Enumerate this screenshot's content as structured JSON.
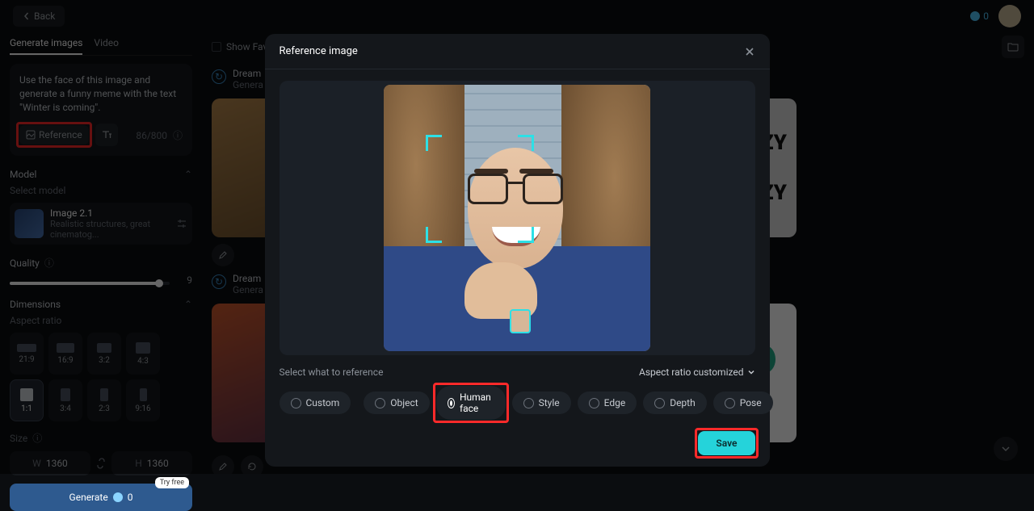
{
  "topbar": {
    "back": "Back",
    "credits": "0"
  },
  "tabs": {
    "generate_images": "Generate images",
    "video": "Video"
  },
  "prompt": {
    "text": "Use the face of this image and generate a funny meme with the text \"Winter is coming\".",
    "reference_label": "Reference",
    "char_counter": "86/800"
  },
  "model": {
    "header": "Model",
    "select_label": "Select model",
    "name": "Image 2.1",
    "desc": "Realistic structures, great cinematog..."
  },
  "quality": {
    "header": "Quality",
    "value": "9"
  },
  "dimensions": {
    "header": "Dimensions",
    "aspect_label": "Aspect ratio",
    "ratios": [
      "21:9",
      "16:9",
      "3:2",
      "4:3",
      "1:1",
      "3:4",
      "2:3",
      "9:16"
    ],
    "selected": "1:1",
    "size_label": "Size",
    "w_letter": "W",
    "h_letter": "H",
    "w": "1360",
    "h": "1360"
  },
  "generate": {
    "label": "Generate",
    "cost": "0",
    "try_free": "Try free"
  },
  "content": {
    "show_favorites": "Show Favor",
    "block_title": "Dream",
    "block_sub": "Genera"
  },
  "modal": {
    "title": "Reference image",
    "select_label": "Select what to reference",
    "aspect_custom": "Aspect ratio customized",
    "chips": {
      "custom": "Custom",
      "object": "Object",
      "human_face": "Human face",
      "style": "Style",
      "edge": "Edge",
      "depth": "Depth",
      "pose": "Pose"
    },
    "save": "Save"
  }
}
